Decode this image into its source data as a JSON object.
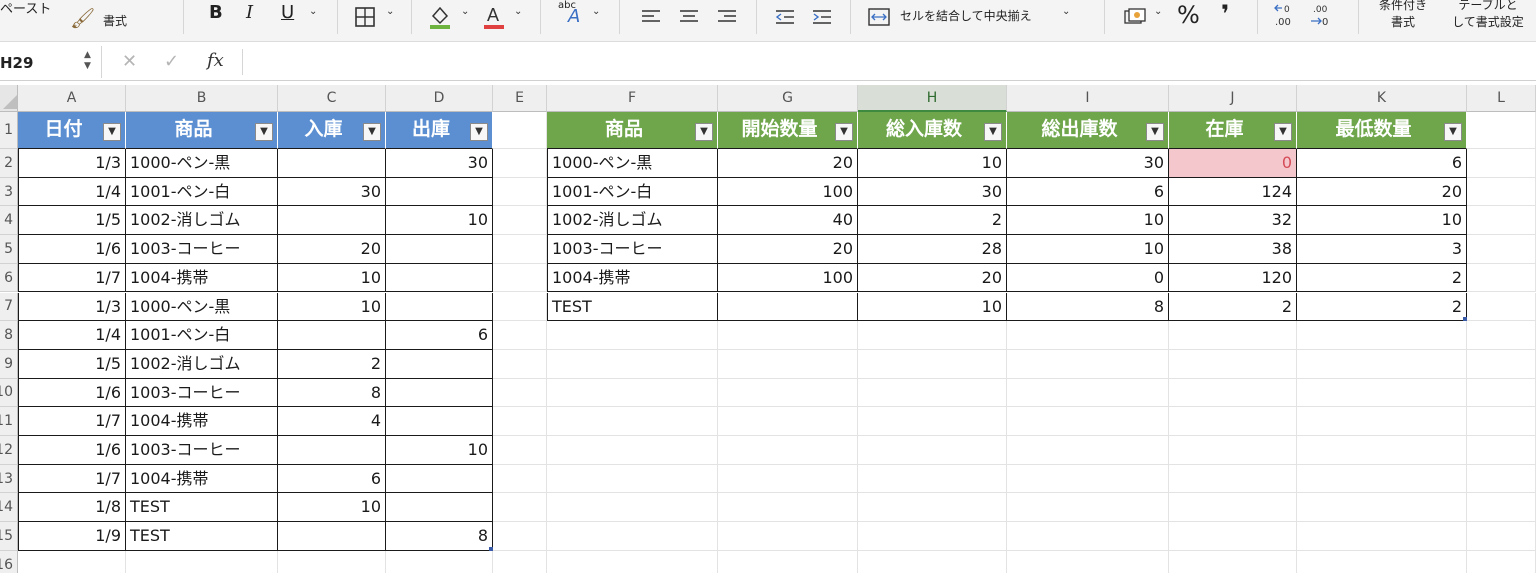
{
  "ribbon": {
    "paste": "ペースト",
    "format_painter": "書式",
    "bold": "B",
    "italic": "I",
    "underline": "U",
    "orientation": "abc",
    "merge_center": "セルを結合して中央揃え",
    "percent": "%",
    "comma": "❜",
    "cond_format_line1": "条件付き",
    "cond_format_line2": "書式",
    "table_format_line1": "テーブルと",
    "table_format_line2": "して書式設定",
    "chevron": "⌄"
  },
  "formula_bar": {
    "name_box": "H29",
    "cancel": "✕",
    "enter": "✓",
    "fx": "fx",
    "formula": ""
  },
  "columns": [
    "A",
    "B",
    "C",
    "D",
    "E",
    "F",
    "G",
    "H",
    "I",
    "J",
    "K",
    "L"
  ],
  "rows": [
    "1",
    "2",
    "3",
    "4",
    "5",
    "6",
    "7",
    "8",
    "9",
    "10",
    "11",
    "12",
    "13",
    "14",
    "15",
    "16"
  ],
  "left_table": {
    "headers": [
      "日付",
      "商品",
      "入庫",
      "出庫"
    ],
    "rows": [
      [
        "1/3",
        "1000-ペン-黒",
        "",
        "30"
      ],
      [
        "1/4",
        "1001-ペン-白",
        "30",
        ""
      ],
      [
        "1/5",
        "1002-消しゴム",
        "",
        "10"
      ],
      [
        "1/6",
        "1003-コーヒー",
        "20",
        ""
      ],
      [
        "1/7",
        "1004-携帯",
        "10",
        ""
      ],
      [
        "1/3",
        "1000-ペン-黒",
        "10",
        ""
      ],
      [
        "1/4",
        "1001-ペン-白",
        "",
        "6"
      ],
      [
        "1/5",
        "1002-消しゴム",
        "2",
        ""
      ],
      [
        "1/6",
        "1003-コーヒー",
        "8",
        ""
      ],
      [
        "1/7",
        "1004-携帯",
        "4",
        ""
      ],
      [
        "1/6",
        "1003-コーヒー",
        "",
        "10"
      ],
      [
        "1/7",
        "1004-携帯",
        "6",
        ""
      ],
      [
        "1/8",
        "TEST",
        "10",
        ""
      ],
      [
        "1/9",
        "TEST",
        "",
        "8"
      ]
    ]
  },
  "right_table": {
    "headers": [
      "商品",
      "開始数量",
      "総入庫数",
      "総出庫数",
      "在庫",
      "最低数量"
    ],
    "rows": [
      [
        "1000-ペン-黒",
        "20",
        "10",
        "30",
        "0",
        "6"
      ],
      [
        "1001-ペン-白",
        "100",
        "30",
        "6",
        "124",
        "20"
      ],
      [
        "1002-消しゴム",
        "40",
        "2",
        "10",
        "32",
        "10"
      ],
      [
        "1003-コーヒー",
        "20",
        "28",
        "10",
        "38",
        "3"
      ],
      [
        "1004-携帯",
        "100",
        "20",
        "0",
        "120",
        "2"
      ],
      [
        "TEST",
        "",
        "10",
        "8",
        "2",
        "2"
      ]
    ]
  },
  "colors": {
    "left_header": "#5b8fd2",
    "right_header": "#6fa64c",
    "low_stock_fill": "#f4c7cc",
    "low_stock_text": "#d54b57",
    "selected_column": "#3e8a3e"
  },
  "selected_cell": "H29"
}
